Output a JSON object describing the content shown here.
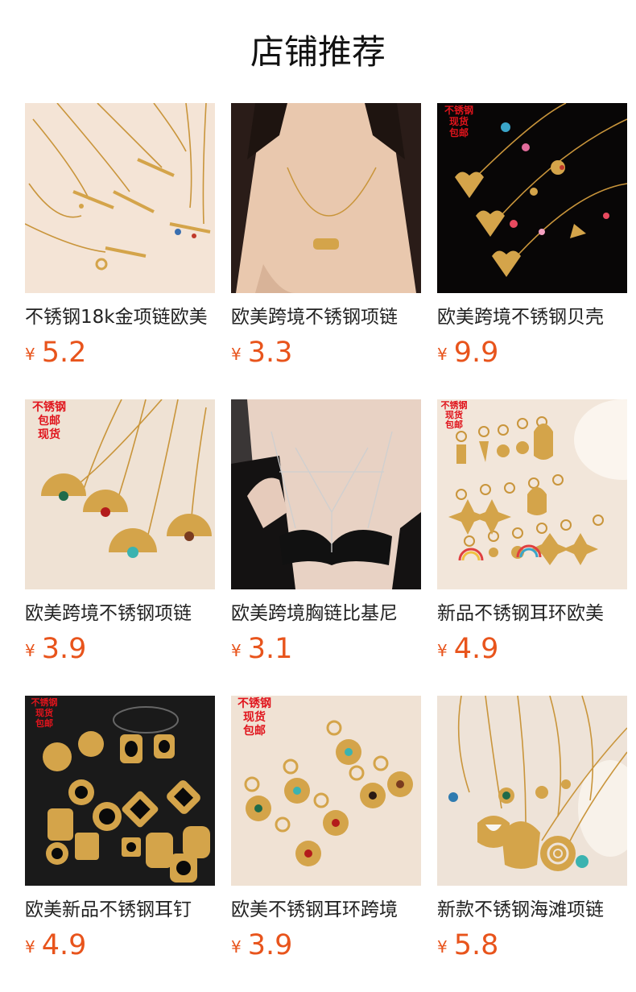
{
  "page": {
    "title": "店铺推荐"
  },
  "currency_symbol": "¥",
  "products": [
    {
      "name": "不锈钢18k金项链欧美",
      "price": "5.2",
      "stamp": ""
    },
    {
      "name": "欧美跨境不锈钢项链",
      "price": "3.3",
      "stamp": ""
    },
    {
      "name": "欧美跨境不锈钢贝壳",
      "price": "9.9",
      "stamp": "不锈钢\n现货\n包邮"
    },
    {
      "name": "欧美跨境不锈钢项链",
      "price": "3.9",
      "stamp": "不锈钢\n包邮\n现货"
    },
    {
      "name": "欧美跨境胸链比基尼",
      "price": "3.1",
      "stamp": ""
    },
    {
      "name": "新品不锈钢耳环欧美",
      "price": "4.9",
      "stamp": "不锈钢\n现货\n包邮"
    },
    {
      "name": "欧美新品不锈钢耳钉",
      "price": "4.9",
      "stamp": "不锈钢\n现货\n包邮"
    },
    {
      "name": "欧美不锈钢耳环跨境",
      "price": "3.9",
      "stamp": "不锈钢\n现货\n包邮"
    },
    {
      "name": "新款不锈钢海滩项链",
      "price": "5.8",
      "stamp": ""
    }
  ],
  "colors": {
    "price": "#e8541c",
    "stamp": "#e0141c",
    "gold": "#d9a441"
  }
}
